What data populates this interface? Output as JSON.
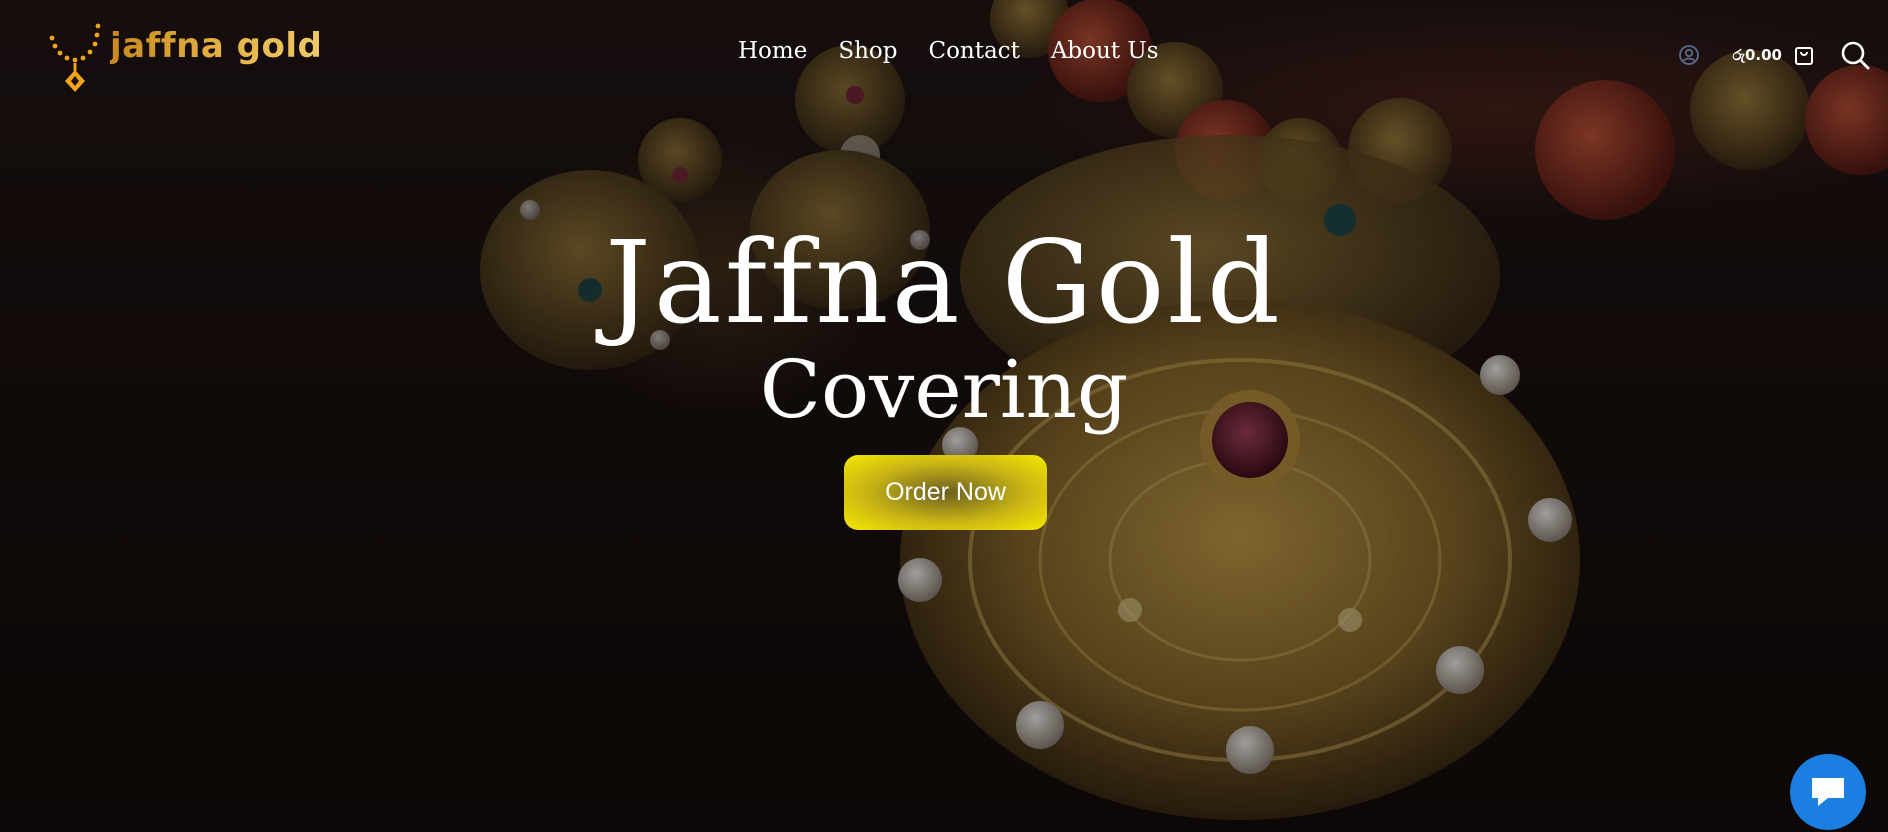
{
  "brand": {
    "logo_text": "jaffna gold",
    "colors": {
      "gold": "#e0a93a",
      "accent_yellow": "#f5ea00",
      "chat_blue": "#1a7fe0"
    }
  },
  "nav": {
    "items": [
      {
        "label": "Home"
      },
      {
        "label": "Shop"
      },
      {
        "label": "Contact"
      },
      {
        "label": "About Us"
      }
    ]
  },
  "header": {
    "account_icon": "user-circle-icon",
    "cart_total": "රු0.00",
    "cart_icon": "shopping-bag-icon",
    "search_icon": "search-icon"
  },
  "hero": {
    "title": "Jaffna Gold",
    "subtitle": "Covering",
    "cta_label": "Order Now"
  },
  "chat": {
    "icon": "chat-bubble-icon"
  }
}
